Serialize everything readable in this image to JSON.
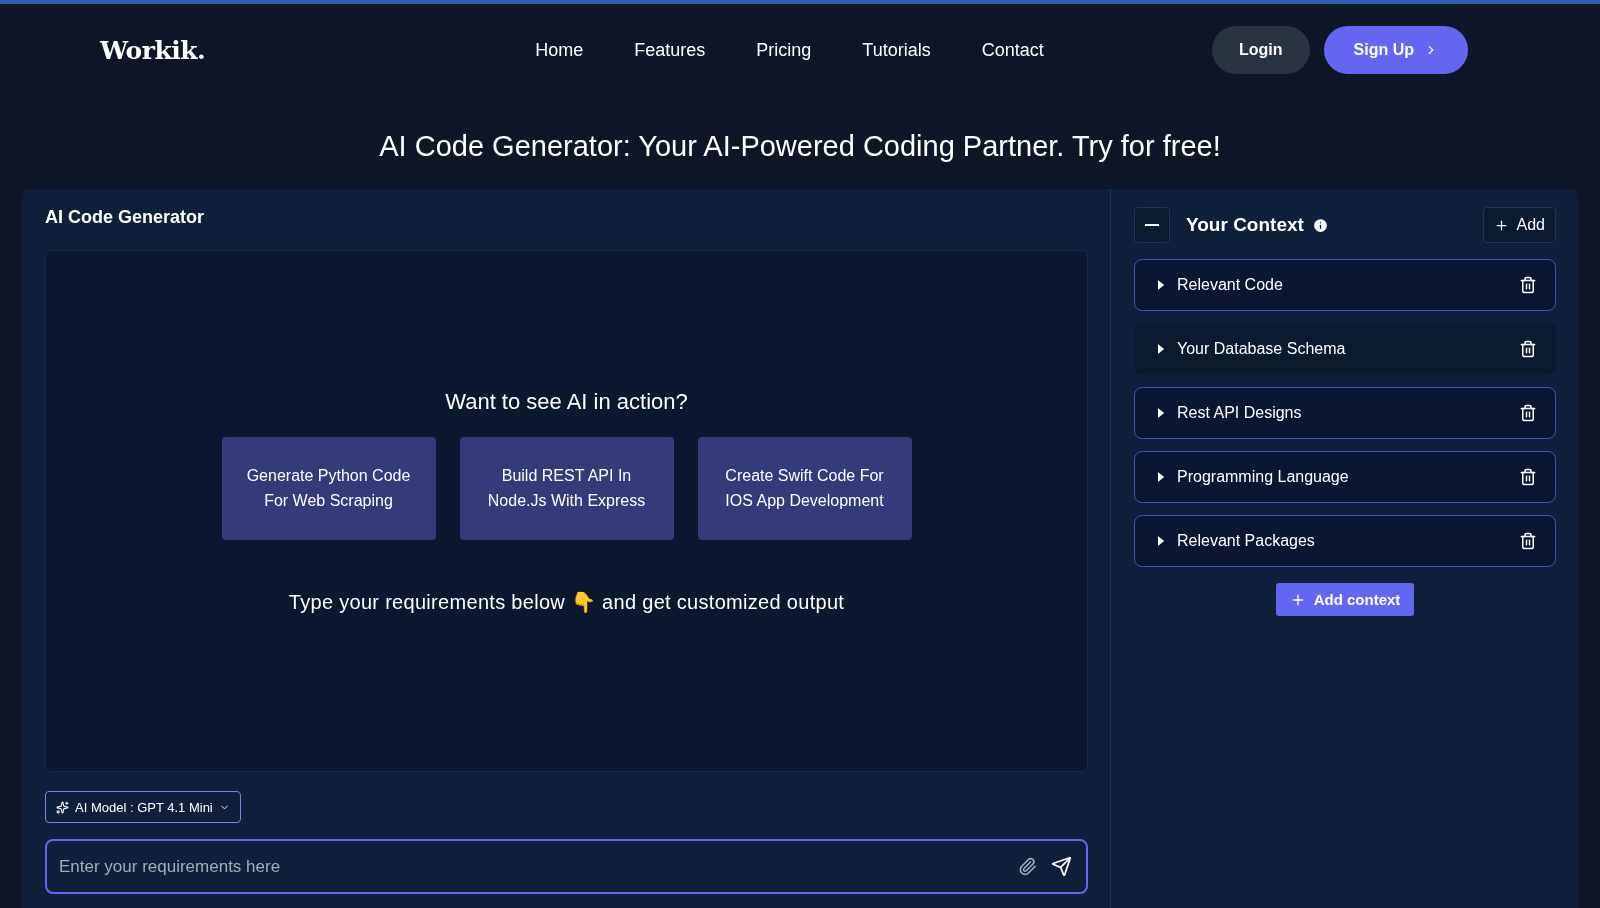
{
  "nav": {
    "logo": "Workik.",
    "links": [
      "Home",
      "Features",
      "Pricing",
      "Tutorials",
      "Contact"
    ],
    "login": "Login",
    "signup": "Sign Up"
  },
  "headline": "AI Code Generator: Your AI-Powered Coding Partner. Try for free!",
  "generator": {
    "title": "AI Code Generator",
    "prompt_title": "Want to see AI in action?",
    "suggestions": [
      "Generate Python Code For Web Scraping",
      "Build REST API In Node.Js With Express",
      "Create Swift Code For IOS App Development"
    ],
    "hint_before": "Type your requirements below",
    "hint_emoji": "👇",
    "hint_after": "and get customized output",
    "model": "AI Model : GPT 4.1 Mini",
    "input": {
      "placeholder": "Enter your requirements here"
    }
  },
  "context": {
    "title": "Your Context",
    "add": "Add",
    "add_context": "Add context",
    "items": [
      {
        "label": "Relevant Code",
        "selected": false
      },
      {
        "label": "Your Database Schema",
        "selected": true
      },
      {
        "label": "Rest API Designs",
        "selected": false
      },
      {
        "label": "Programming Language",
        "selected": false
      },
      {
        "label": "Relevant Packages",
        "selected": false
      }
    ]
  }
}
